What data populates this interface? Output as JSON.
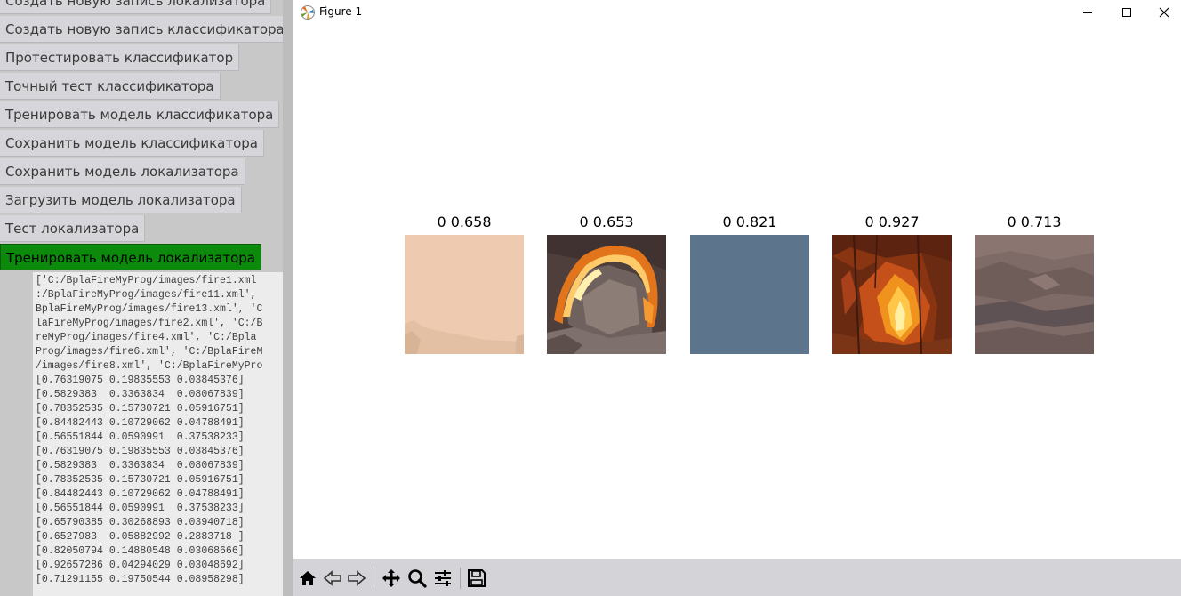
{
  "left_app": {
    "buttons": [
      {
        "label": "Создать новую запись локализатора",
        "active": false
      },
      {
        "label": "Создать новую запись классификатора",
        "active": false
      },
      {
        "label": "Протестировать классификатор",
        "active": false
      },
      {
        "label": "Точный тест классификатора",
        "active": false
      },
      {
        "label": "Тренировать модель классификатора",
        "active": false
      },
      {
        "label": "Сохранить модель классификатора",
        "active": false
      },
      {
        "label": "Сохранить модель локализатора",
        "active": false
      },
      {
        "label": "Загрузить модель локализатора",
        "active": false
      },
      {
        "label": "Тест локализатора",
        "active": false
      },
      {
        "label": "Тренировать модель локализатора",
        "active": true
      }
    ],
    "log_lines": [
      "['C:/BplaFireMyProg/images/fire1.xml",
      ":/BplaFireMyProg/images/fire11.xml',",
      "BplaFireMyProg/images/fire13.xml', 'C",
      "laFireMyProg/images/fire2.xml', 'C:/B",
      "reMyProg/images/fire4.xml', 'C:/Bpla",
      "Prog/images/fire6.xml', 'C:/BplaFireM",
      "/images/fire8.xml', 'C:/BplaFireMyPro",
      "[0.76319075 0.19835553 0.03845376]",
      "[0.5829383  0.3363834  0.08067839]",
      "[0.78352535 0.15730721 0.05916751]",
      "[0.84482443 0.10729062 0.04788491]",
      "[0.56551844 0.0590991  0.37538233]",
      "[0.76319075 0.19835553 0.03845376]",
      "[0.5829383  0.3363834  0.08067839]",
      "[0.78352535 0.15730721 0.05916751]",
      "[0.84482443 0.10729062 0.04788491]",
      "[0.56551844 0.0590991  0.37538233]",
      "[0.65790385 0.30268893 0.03940718]",
      "[0.6527983  0.05882992 0.2883718 ]",
      "[0.82050794 0.14880548 0.03068666]",
      "[0.92657286 0.04294029 0.03048692]",
      "[0.71291155 0.19750544 0.08958298]"
    ]
  },
  "figure_window": {
    "title": "Figure 1",
    "controls": {
      "minimize": "minimize-icon",
      "maximize": "maximize-icon",
      "close": "close-icon"
    },
    "subplots": [
      {
        "title": "0 0.658",
        "image": "peach-flat",
        "colors": [
          "#eecab0",
          "#e3bea1",
          "#d4b39a"
        ]
      },
      {
        "title": "0 0.653",
        "image": "fire-arch",
        "colors": [
          "#4b3b37",
          "#8a7468",
          "#f07a1a",
          "#ffd07a"
        ]
      },
      {
        "title": "0 0.821",
        "image": "slate-flat",
        "colors": [
          "#5c758c"
        ]
      },
      {
        "title": "0 0.927",
        "image": "forest-fire",
        "colors": [
          "#6a2a12",
          "#c24a12",
          "#f59b1e",
          "#ffe28a"
        ]
      },
      {
        "title": "0 0.713",
        "image": "smoke-terrain",
        "colors": [
          "#7a6662",
          "#6a5a58",
          "#8b7470",
          "#5a4e50"
        ]
      }
    ],
    "toolbar": [
      {
        "name": "home-icon"
      },
      {
        "name": "back-arrow-icon"
      },
      {
        "name": "forward-arrow-icon"
      },
      {
        "name": "pan-icon"
      },
      {
        "name": "zoom-icon"
      },
      {
        "name": "configure-subplots-icon"
      },
      {
        "name": "save-icon"
      }
    ]
  }
}
